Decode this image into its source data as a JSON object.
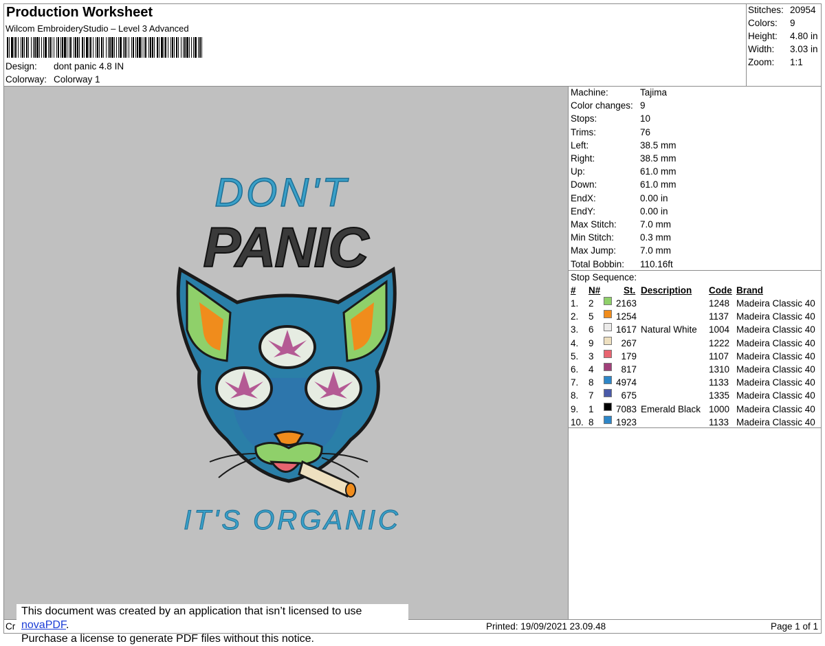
{
  "header": {
    "title": "Production Worksheet",
    "software": "Wilcom EmbroideryStudio – Level 3 Advanced",
    "design_label": "Design:",
    "design_value": "dont panic 4.8 IN",
    "colorway_label": "Colorway:",
    "colorway_value": "Colorway 1"
  },
  "summary": [
    {
      "label": "Stitches:",
      "value": "20954"
    },
    {
      "label": "Colors:",
      "value": "9"
    },
    {
      "label": "Height:",
      "value": "4.80 in"
    },
    {
      "label": "Width:",
      "value": "3.03 in"
    },
    {
      "label": "Zoom:",
      "value": "1:1"
    }
  ],
  "machine_info": [
    {
      "label": "Machine:",
      "value": "Tajima"
    },
    {
      "label": "Color changes:",
      "value": "9"
    },
    {
      "label": "Stops:",
      "value": "10"
    },
    {
      "label": "Trims:",
      "value": "76"
    },
    {
      "label": "Left:",
      "value": "38.5 mm"
    },
    {
      "label": "Right:",
      "value": "38.5 mm"
    },
    {
      "label": "Up:",
      "value": "61.0 mm"
    },
    {
      "label": "Down:",
      "value": "61.0 mm"
    },
    {
      "label": "EndX:",
      "value": "0.00 in"
    },
    {
      "label": "EndY:",
      "value": "0.00 in"
    },
    {
      "label": "Max Stitch:",
      "value": "7.0 mm"
    },
    {
      "label": "Min Stitch:",
      "value": "0.3 mm"
    },
    {
      "label": "Max Jump:",
      "value": "7.0 mm"
    },
    {
      "label": "Total Bobbin:",
      "value": "110.16ft"
    }
  ],
  "stop_sequence": {
    "title": "Stop Sequence:",
    "headers": {
      "num": "#",
      "n": "N#",
      "st": "St.",
      "description": "Description",
      "code": "Code",
      "brand": "Brand"
    },
    "rows": [
      {
        "num": "1.",
        "n": "2",
        "color": "#8fd06a",
        "st": "2163",
        "description": "",
        "code": "1248",
        "brand": "Madeira Classic 40"
      },
      {
        "num": "2.",
        "n": "5",
        "color": "#f08c1c",
        "st": "1254",
        "description": "",
        "code": "1137",
        "brand": "Madeira Classic 40"
      },
      {
        "num": "3.",
        "n": "6",
        "color": "#ecebea",
        "st": "1617",
        "description": "Natural White",
        "code": "1004",
        "brand": "Madeira Classic 40"
      },
      {
        "num": "4.",
        "n": "9",
        "color": "#eee0c0",
        "st": "267",
        "description": "",
        "code": "1222",
        "brand": "Madeira Classic 40"
      },
      {
        "num": "5.",
        "n": "3",
        "color": "#e86470",
        "st": "179",
        "description": "",
        "code": "1107",
        "brand": "Madeira Classic 40"
      },
      {
        "num": "6.",
        "n": "4",
        "color": "#a0407a",
        "st": "817",
        "description": "",
        "code": "1310",
        "brand": "Madeira Classic 40"
      },
      {
        "num": "7.",
        "n": "8",
        "color": "#2e86c8",
        "st": "4974",
        "description": "",
        "code": "1133",
        "brand": "Madeira Classic 40"
      },
      {
        "num": "8.",
        "n": "7",
        "color": "#4a5aa8",
        "st": "675",
        "description": "",
        "code": "1335",
        "brand": "Madeira Classic 40"
      },
      {
        "num": "9.",
        "n": "1",
        "color": "#000000",
        "st": "7083",
        "description": "Emerald Black",
        "code": "1000",
        "brand": "Madeira Classic 40"
      },
      {
        "num": "10.",
        "n": "8",
        "color": "#2e86c8",
        "st": "1923",
        "description": "",
        "code": "1133",
        "brand": "Madeira Classic 40"
      }
    ]
  },
  "design": {
    "line1": "DON'T",
    "line2": "PANIC",
    "line3": "IT'S ORGANIC"
  },
  "footer": {
    "left_fragment": "Cr",
    "printed": "Printed: 19/09/2021 23.09.48",
    "page": "Page 1 of 1"
  },
  "notice": {
    "line1_prefix": "This document was created by an application that isn’t licensed to use ",
    "link": "novaPDF",
    "line1_suffix": ".",
    "line2": "Purchase a license to generate PDF files without this notice."
  }
}
